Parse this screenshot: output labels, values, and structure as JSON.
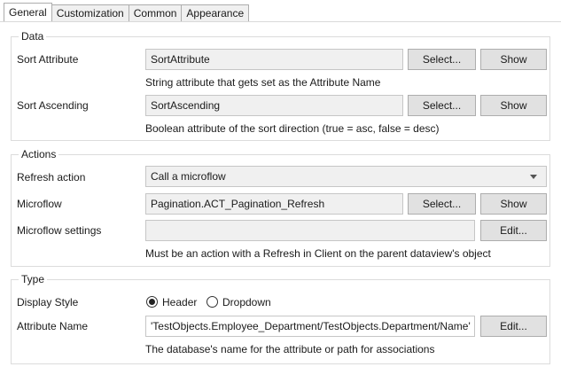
{
  "tabs": [
    {
      "label": "General",
      "active": true
    },
    {
      "label": "Customization",
      "active": false
    },
    {
      "label": "Common",
      "active": false
    },
    {
      "label": "Appearance",
      "active": false
    }
  ],
  "data_group": {
    "title": "Data",
    "sort_attribute": {
      "label": "Sort Attribute",
      "value": "SortAttribute",
      "select_label": "Select...",
      "show_label": "Show",
      "hint": "String attribute that gets set as the Attribute Name"
    },
    "sort_ascending": {
      "label": "Sort Ascending",
      "value": "SortAscending",
      "select_label": "Select...",
      "show_label": "Show",
      "hint": "Boolean attribute of the sort direction (true = asc, false = desc)"
    }
  },
  "actions_group": {
    "title": "Actions",
    "refresh_action": {
      "label": "Refresh action",
      "value": "Call a microflow"
    },
    "microflow": {
      "label": "Microflow",
      "value": "Pagination.ACT_Pagination_Refresh",
      "select_label": "Select...",
      "show_label": "Show"
    },
    "microflow_settings": {
      "label": "Microflow settings",
      "value": "",
      "edit_label": "Edit...",
      "hint": "Must be an action with a Refresh in Client on the parent dataview's object"
    }
  },
  "type_group": {
    "title": "Type",
    "display_style": {
      "label": "Display Style",
      "options": [
        {
          "label": "Header",
          "checked": true
        },
        {
          "label": "Dropdown",
          "checked": false
        }
      ]
    },
    "attribute_name": {
      "label": "Attribute Name",
      "value": "'TestObjects.Employee_Department/TestObjects.Department/Name'",
      "edit_label": "Edit...",
      "hint": "The database's name for the attribute or path for associations"
    }
  }
}
